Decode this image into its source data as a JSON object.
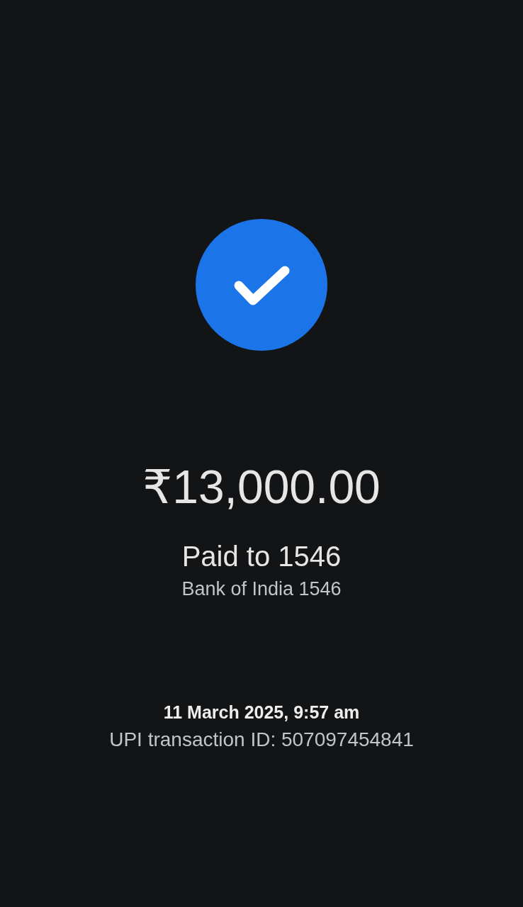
{
  "payment_successful": true,
  "amount": "₹13,000.00",
  "recipient": {
    "title": "Paid to 1546",
    "account": "Bank of India 1546"
  },
  "transaction": {
    "datetime": "11 March 2025, 9:57 am",
    "reference": "UPI transaction ID: 507097454841"
  }
}
